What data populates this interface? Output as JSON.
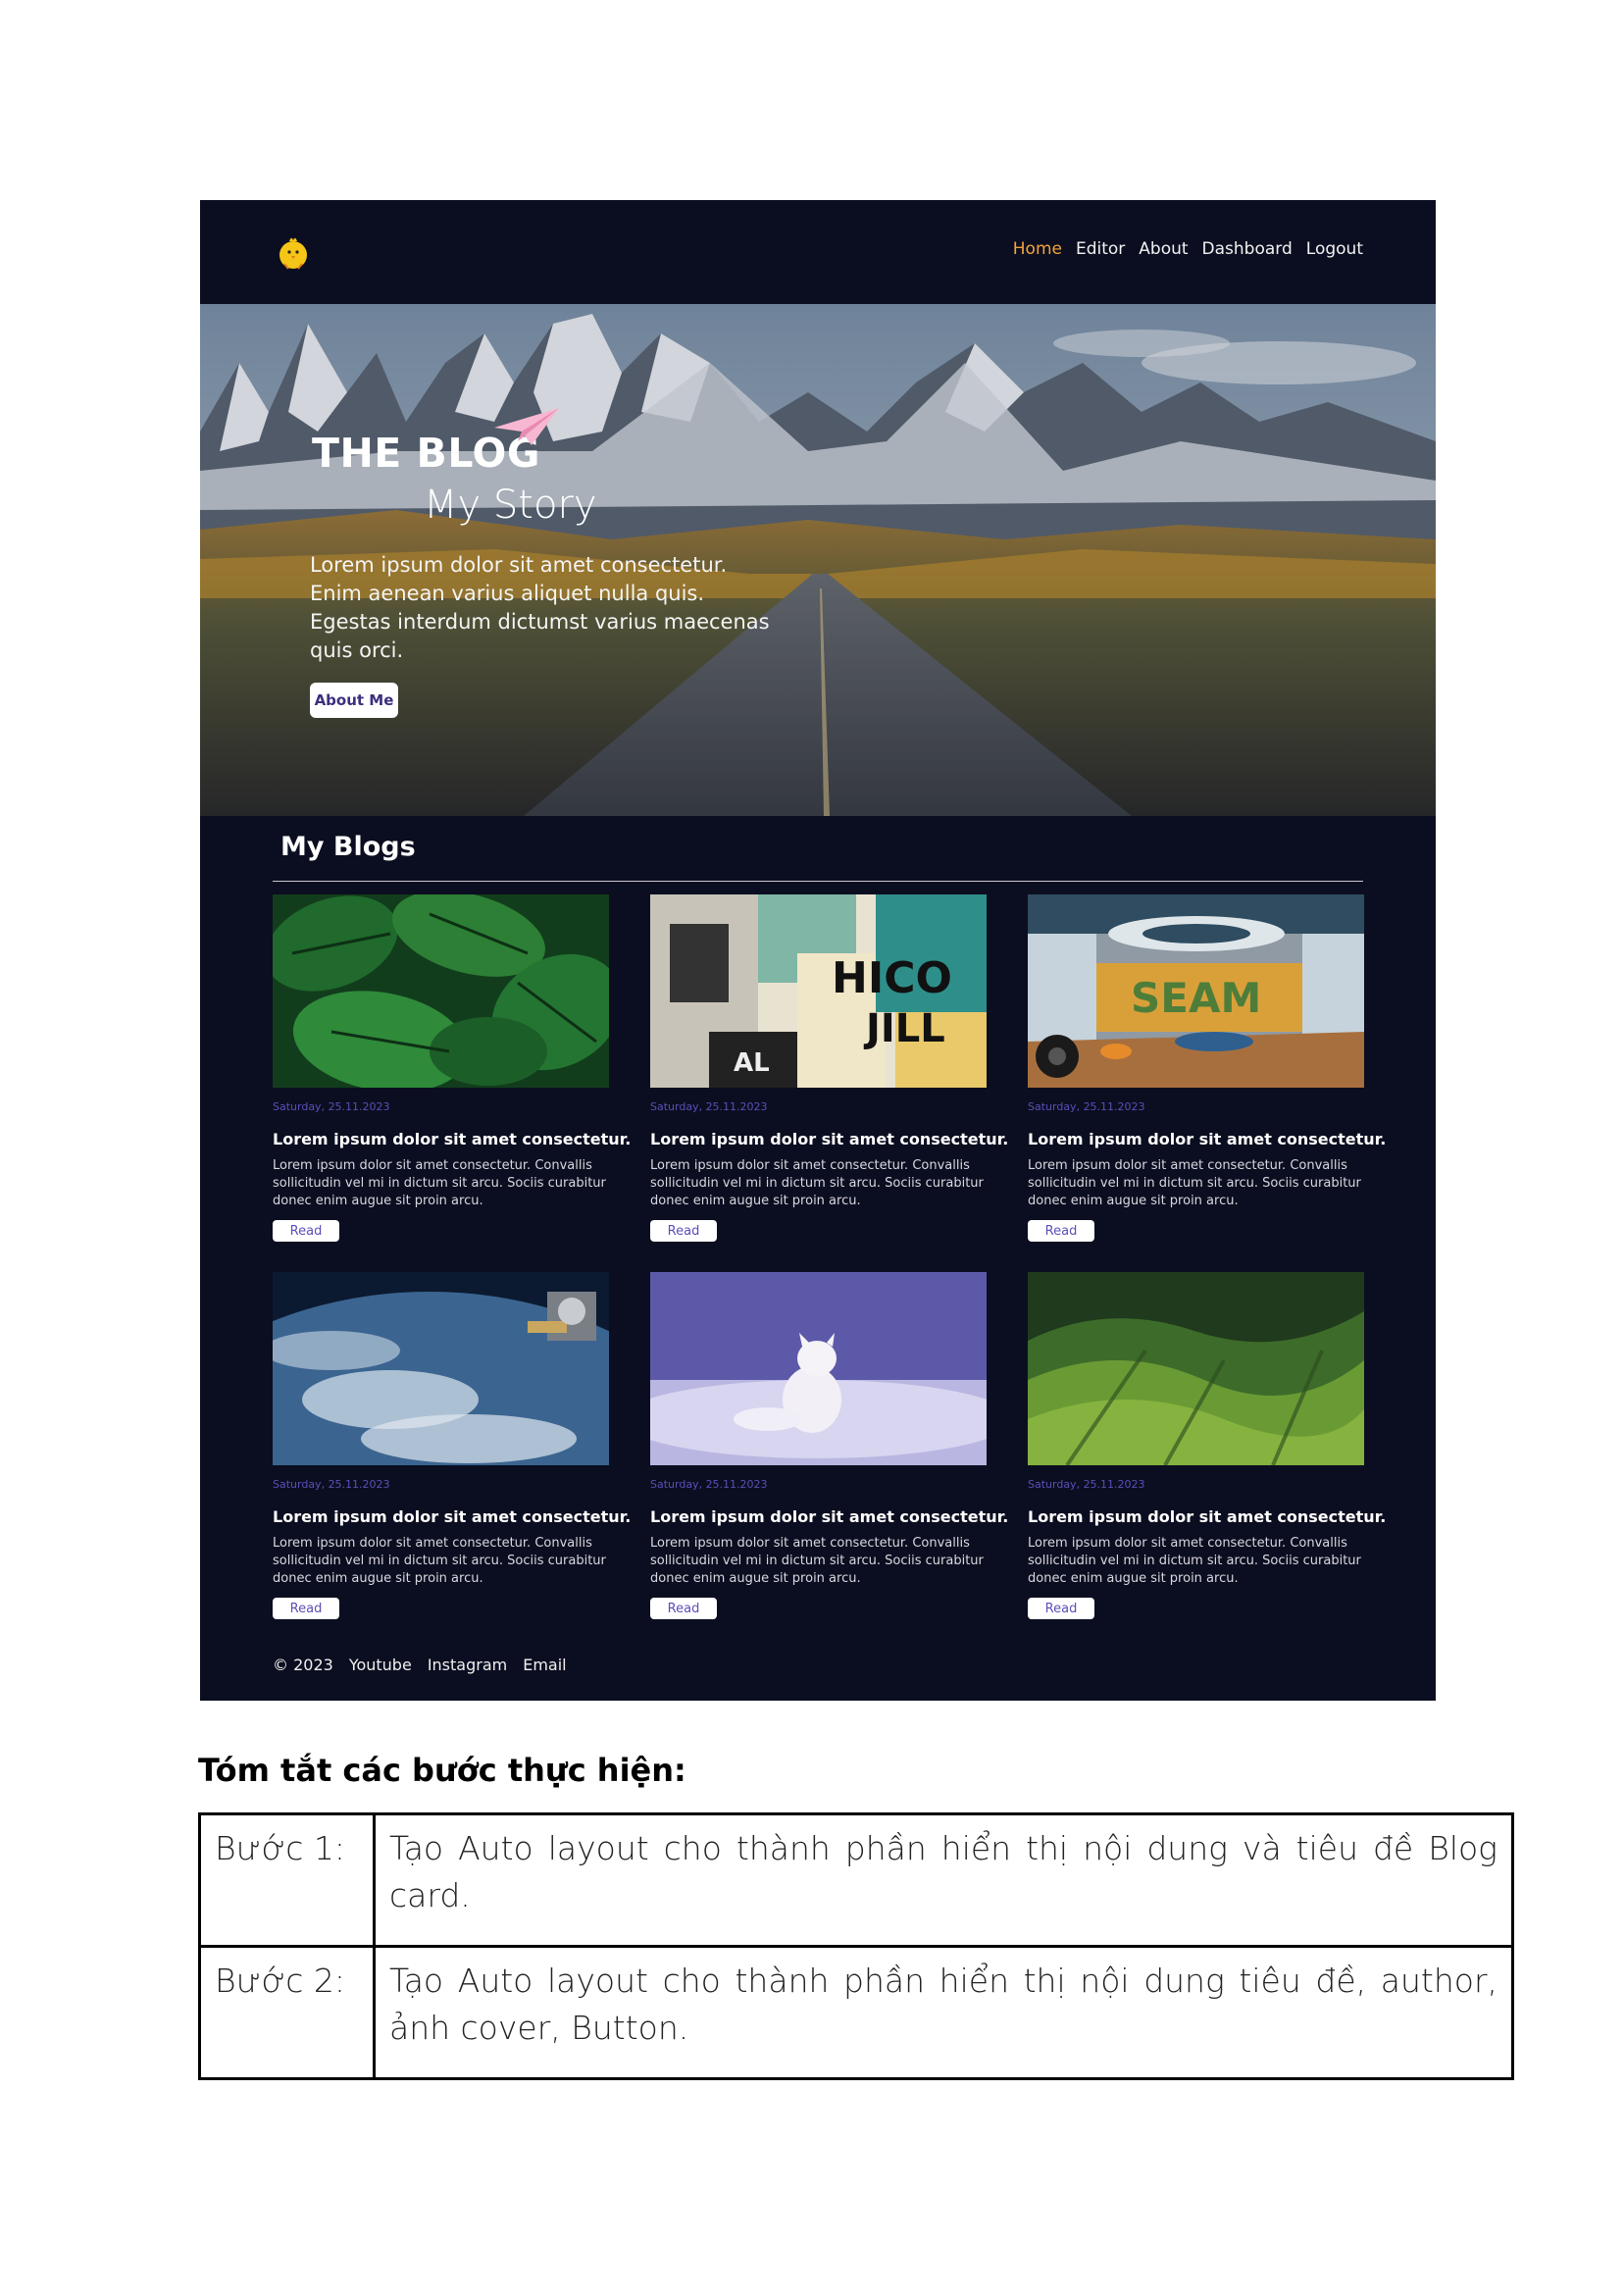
{
  "nav": {
    "items": [
      "Home",
      "Editor",
      "About",
      "Dashboard",
      "Logout"
    ],
    "active": "Home"
  },
  "hero": {
    "title": "THE BLOG",
    "subtitle": "My Story",
    "text": "Lorem ipsum dolor sit amet consectetur. Enim aenean varius aliquet nulla quis. Egestas interdum dictumst varius maecenas quis orci.",
    "button": "About Me"
  },
  "blogs": {
    "heading": "My Blogs",
    "cards": [
      {
        "date": "Saturday, 25.11.2023",
        "title": "Lorem ipsum dolor sit amet consectetur.",
        "text": "Lorem ipsum dolor sit amet consectetur. Convallis sollicitudin vel mi in dictum sit arcu. Sociis curabitur donec enim augue sit proin arcu.",
        "button": "Read",
        "image": "monstera-leaves"
      },
      {
        "date": "Saturday, 25.11.2023",
        "title": "Lorem ipsum dolor sit amet consectetur.",
        "text": "Lorem ipsum dolor sit amet consectetur. Convallis sollicitudin vel mi in dictum sit arcu. Sociis curabitur donec enim augue sit proin arcu.",
        "button": "Read",
        "image": "torn-posters"
      },
      {
        "date": "Saturday, 25.11.2023",
        "title": "Lorem ipsum dolor sit amet consectetur.",
        "text": "Lorem ipsum dolor sit amet consectetur. Convallis sollicitudin vel mi in dictum sit arcu. Sociis curabitur donec enim augue sit proin arcu.",
        "button": "Read",
        "image": "steam-room"
      },
      {
        "date": "Saturday, 25.11.2023",
        "title": "Lorem ipsum dolor sit amet consectetur.",
        "text": "Lorem ipsum dolor sit amet consectetur. Convallis sollicitudin vel mi in dictum sit arcu. Sociis curabitur donec enim augue sit proin arcu.",
        "button": "Read",
        "image": "earth-from-space"
      },
      {
        "date": "Saturday, 25.11.2023",
        "title": "Lorem ipsum dolor sit amet consectetur.",
        "text": "Lorem ipsum dolor sit amet consectetur. Convallis sollicitudin vel mi in dictum sit arcu. Sociis curabitur donec enim augue sit proin arcu.",
        "button": "Read",
        "image": "arctic-fox"
      },
      {
        "date": "Saturday, 25.11.2023",
        "title": "Lorem ipsum dolor sit amet consectetur.",
        "text": "Lorem ipsum dolor sit amet consectetur. Convallis sollicitudin vel mi in dictum sit arcu. Sociis curabitur donec enim augue sit proin arcu.",
        "button": "Read",
        "image": "green-hills"
      }
    ]
  },
  "footer": {
    "items": [
      "© 2023",
      "Youtube",
      "Instagram",
      "Email"
    ]
  },
  "summary": {
    "heading": "Tóm tắt các bước thực hiện:",
    "steps": [
      {
        "label": "Bước 1:",
        "text": "Tạo Auto layout cho thành phần hiển thị nội dung và tiêu đề Blog card."
      },
      {
        "label": "Bước 2:",
        "text": "Tạo Auto layout cho thành phần hiển thị nội dung tiêu đề, author, ảnh cover, Button."
      }
    ]
  },
  "colors": {
    "page_bg": "#0b0e20",
    "nav_active": "#f0a43c",
    "accent_purple": "#5a4fb8"
  }
}
